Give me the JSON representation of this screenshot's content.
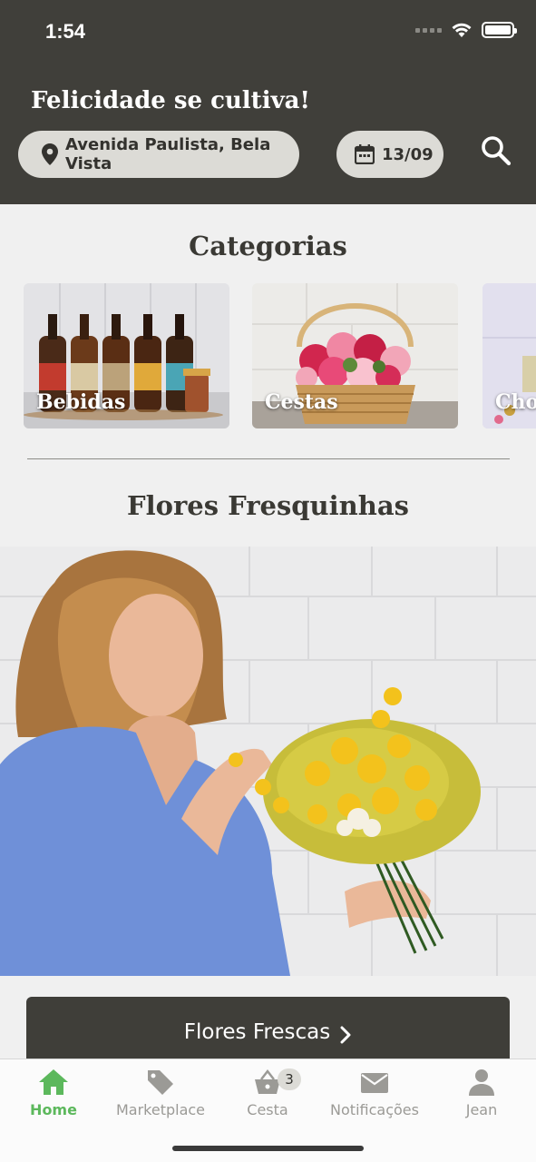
{
  "status": {
    "time": "1:54"
  },
  "header": {
    "tagline": "Felicidade se cultiva!",
    "location": "Avenida Paulista, Bela Vista",
    "date": "13/09"
  },
  "categories": {
    "title": "Categorias",
    "items": [
      {
        "label": "Bebidas"
      },
      {
        "label": "Cestas"
      },
      {
        "label": "Cho"
      }
    ]
  },
  "featured": {
    "title": "Flores Fresquinhas",
    "button_label": "Flores Frescas"
  },
  "tabbar": {
    "items": [
      {
        "label": "Home",
        "icon": "home-icon"
      },
      {
        "label": "Marketplace",
        "icon": "tag-icon"
      },
      {
        "label": "Cesta",
        "icon": "basket-icon",
        "badge": "3"
      },
      {
        "label": "Notificações",
        "icon": "mail-icon"
      },
      {
        "label": "Jean",
        "icon": "user-icon"
      }
    ]
  },
  "colors": {
    "header_bg": "#403f3a",
    "accent_green": "#5cb85c",
    "pill_bg": "#dcdbd6"
  }
}
